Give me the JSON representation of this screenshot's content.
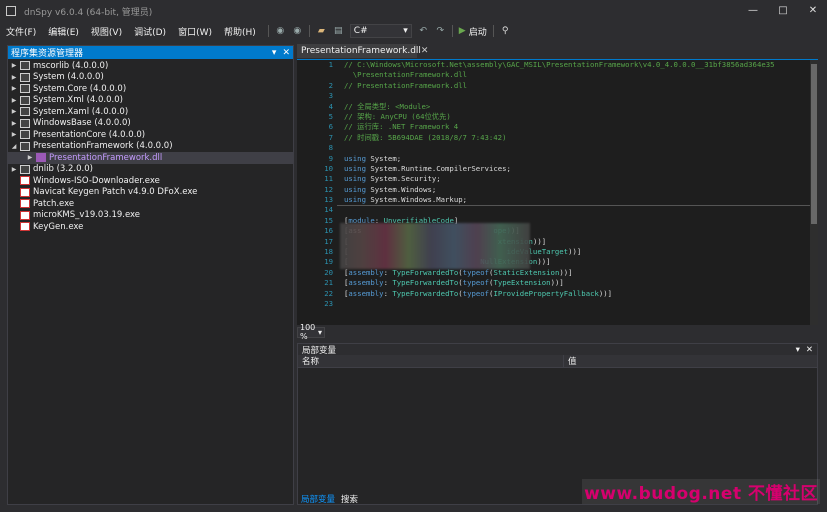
{
  "window": {
    "title": "dnSpy v6.0.4 (64-bit, 管理员)",
    "controls": [
      "—",
      "□",
      "✕"
    ]
  },
  "menu": [
    "文件(F)",
    "编辑(E)",
    "视图(V)",
    "调试(D)",
    "窗口(W)",
    "帮助(H)"
  ],
  "toolbar": {
    "language": "C#",
    "start_label": "启动"
  },
  "explorer": {
    "title": "程序集资源管理器",
    "items": [
      {
        "label": "mscorlib (4.0.0.0)",
        "type": "lib",
        "toggle": "▶",
        "indent": 0
      },
      {
        "label": "System (4.0.0.0)",
        "type": "lib",
        "toggle": "▶",
        "indent": 0
      },
      {
        "label": "System.Core (4.0.0.0)",
        "type": "lib",
        "toggle": "▶",
        "indent": 0
      },
      {
        "label": "System.Xml (4.0.0.0)",
        "type": "lib",
        "toggle": "▶",
        "indent": 0
      },
      {
        "label": "System.Xaml (4.0.0.0)",
        "type": "lib",
        "toggle": "▶",
        "indent": 0
      },
      {
        "label": "WindowsBase (4.0.0.0)",
        "type": "lib",
        "toggle": "▶",
        "indent": 0
      },
      {
        "label": "PresentationCore (4.0.0.0)",
        "type": "lib",
        "toggle": "▶",
        "indent": 0
      },
      {
        "label": "PresentationFramework (4.0.0.0)",
        "type": "lib",
        "toggle": "◢",
        "indent": 0
      },
      {
        "label": "PresentationFramework.dll",
        "type": "ns",
        "toggle": "▶",
        "indent": 1,
        "selected": true
      },
      {
        "label": "dnlib (3.2.0.0)",
        "type": "lib",
        "toggle": "▶",
        "indent": 0
      },
      {
        "label": "Windows-ISO-Downloader.exe",
        "type": "exe",
        "toggle": "",
        "indent": 0
      },
      {
        "label": "Navicat Keygen Patch v4.9.0 DFoX.exe",
        "type": "exe",
        "toggle": "",
        "indent": 0
      },
      {
        "label": "Patch.exe",
        "type": "exe",
        "toggle": "",
        "indent": 0
      },
      {
        "label": "microKMS_v19.03.19.exe",
        "type": "exe",
        "toggle": "",
        "indent": 0
      },
      {
        "label": "KeyGen.exe",
        "type": "exe",
        "toggle": "",
        "indent": 0
      }
    ]
  },
  "editor": {
    "tab_label": "PresentationFramework.dll",
    "zoom": "100 %",
    "lines": [
      {
        "n": "1",
        "parts": [
          {
            "t": "// C:\\Windows\\Microsoft.Net\\assembly\\GAC_MSIL\\PresentationFramework\\v4.0_4.0.0.0__31bf3856ad364e35",
            "c": "comment"
          }
        ]
      },
      {
        "n": "",
        "parts": [
          {
            "t": "  \\PresentationFramework.dll",
            "c": "comment"
          }
        ]
      },
      {
        "n": "2",
        "parts": [
          {
            "t": "// PresentationFramework.dll",
            "c": "comment"
          }
        ]
      },
      {
        "n": "3",
        "parts": []
      },
      {
        "n": "4",
        "parts": [
          {
            "t": "// 全局类型: <Module>",
            "c": "comment"
          }
        ]
      },
      {
        "n": "5",
        "parts": [
          {
            "t": "// 架构: AnyCPU (64位优先)",
            "c": "comment"
          }
        ]
      },
      {
        "n": "6",
        "parts": [
          {
            "t": "// 运行库: .NET Framework 4",
            "c": "comment"
          }
        ]
      },
      {
        "n": "7",
        "parts": [
          {
            "t": "// 时间戳: 5B694DAE (2018/8/7 7:43:42)",
            "c": "comment"
          }
        ]
      },
      {
        "n": "8",
        "parts": []
      },
      {
        "n": "9",
        "parts": [
          {
            "t": "using ",
            "c": "kw"
          },
          {
            "t": "System",
            "c": "plain"
          },
          {
            "t": ";",
            "c": "plain"
          }
        ]
      },
      {
        "n": "10",
        "parts": [
          {
            "t": "using ",
            "c": "kw"
          },
          {
            "t": "System.Runtime.CompilerServices",
            "c": "plain"
          },
          {
            "t": ";",
            "c": "plain"
          }
        ]
      },
      {
        "n": "11",
        "parts": [
          {
            "t": "using ",
            "c": "kw"
          },
          {
            "t": "System.Security",
            "c": "plain"
          },
          {
            "t": ";",
            "c": "plain"
          }
        ]
      },
      {
        "n": "12",
        "parts": [
          {
            "t": "using ",
            "c": "kw"
          },
          {
            "t": "System.Windows",
            "c": "plain"
          },
          {
            "t": ";",
            "c": "plain"
          }
        ]
      },
      {
        "n": "13",
        "parts": [
          {
            "t": "using ",
            "c": "kw"
          },
          {
            "t": "System.Windows.Markup",
            "c": "plain"
          },
          {
            "t": ";",
            "c": "plain"
          }
        ]
      },
      {
        "n": "14",
        "parts": []
      },
      {
        "n": "15",
        "parts": [
          {
            "t": "[",
            "c": "plain"
          },
          {
            "t": "module",
            "c": "kw"
          },
          {
            "t": ": ",
            "c": "plain"
          },
          {
            "t": "UnverifiableCode",
            "c": "type"
          },
          {
            "t": "]",
            "c": "plain"
          }
        ]
      },
      {
        "n": "16",
        "parts": [
          {
            "t": "[ass",
            "c": "plain"
          },
          {
            "t": "                              ",
            "c": "plain"
          },
          {
            "t": "ope)",
            "c": "type"
          },
          {
            "t": ")]",
            "c": "plain"
          }
        ]
      },
      {
        "n": "17",
        "parts": [
          {
            "t": "[",
            "c": "plain"
          },
          {
            "t": "                                  ",
            "c": "plain"
          },
          {
            "t": "xtension",
            "c": "type"
          },
          {
            "t": "))]",
            "c": "plain"
          }
        ]
      },
      {
        "n": "18",
        "parts": [
          {
            "t": "[",
            "c": "plain"
          },
          {
            "t": "                                    ",
            "c": "plain"
          },
          {
            "t": "ideValueTarget",
            "c": "type"
          },
          {
            "t": "))]",
            "c": "plain"
          }
        ]
      },
      {
        "n": "19",
        "parts": [
          {
            "t": "[",
            "c": "plain"
          },
          {
            "t": "                              ",
            "c": "plain"
          },
          {
            "t": "NullExtension",
            "c": "type"
          },
          {
            "t": "))]",
            "c": "plain"
          }
        ]
      },
      {
        "n": "20",
        "parts": [
          {
            "t": "[",
            "c": "plain"
          },
          {
            "t": "assembly",
            "c": "kw"
          },
          {
            "t": ": ",
            "c": "plain"
          },
          {
            "t": "TypeForwardedTo",
            "c": "type"
          },
          {
            "t": "(",
            "c": "plain"
          },
          {
            "t": "typeof",
            "c": "kw"
          },
          {
            "t": "(",
            "c": "plain"
          },
          {
            "t": "StaticExtension",
            "c": "type"
          },
          {
            "t": "))]",
            "c": "plain"
          }
        ]
      },
      {
        "n": "21",
        "parts": [
          {
            "t": "[",
            "c": "plain"
          },
          {
            "t": "assembly",
            "c": "kw"
          },
          {
            "t": ": ",
            "c": "plain"
          },
          {
            "t": "TypeForwardedTo",
            "c": "type"
          },
          {
            "t": "(",
            "c": "plain"
          },
          {
            "t": "typeof",
            "c": "kw"
          },
          {
            "t": "(",
            "c": "plain"
          },
          {
            "t": "TypeExtension",
            "c": "type"
          },
          {
            "t": "))]",
            "c": "plain"
          }
        ]
      },
      {
        "n": "22",
        "parts": [
          {
            "t": "[",
            "c": "plain"
          },
          {
            "t": "assembly",
            "c": "kw"
          },
          {
            "t": ": ",
            "c": "plain"
          },
          {
            "t": "TypeForwardedTo",
            "c": "type"
          },
          {
            "t": "(",
            "c": "plain"
          },
          {
            "t": "typeof",
            "c": "kw"
          },
          {
            "t": "(",
            "c": "plain"
          },
          {
            "t": "IProvidePropertyFallback",
            "c": "type"
          },
          {
            "t": "))]",
            "c": "plain"
          }
        ]
      },
      {
        "n": "23",
        "parts": []
      }
    ]
  },
  "locals": {
    "title": "局部变量",
    "columns": [
      "名称",
      "值"
    ],
    "tabs": [
      "局部变量",
      "搜索"
    ]
  },
  "watermark": "www.budog.net 不懂社区",
  "colors": {
    "accent": "#007acc",
    "comment": "#57a64a",
    "keyword": "#569cd6",
    "type": "#4ec9b0",
    "watermark": "#d6006e"
  }
}
